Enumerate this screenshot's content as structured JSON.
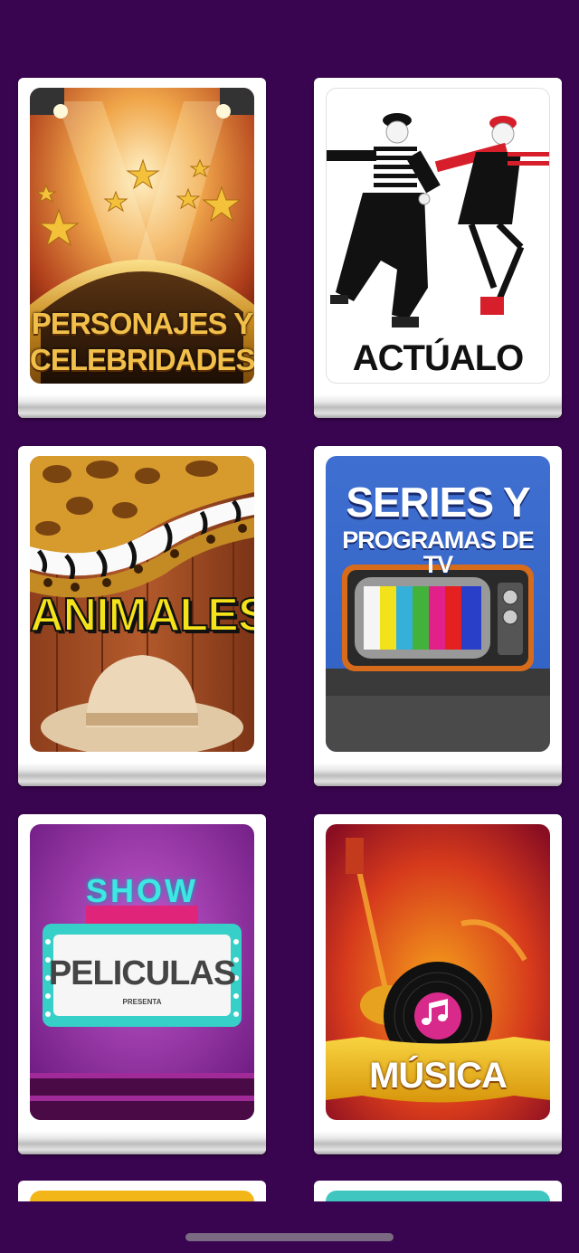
{
  "categories": [
    {
      "title": "PERSONAJES Y CELEBRIDADES",
      "line1": "PERSONAJES Y",
      "line2": "CELEBRIDADES",
      "icon": "spotlight-stars-icon"
    },
    {
      "title": "ACTÚALO",
      "line1": "ACTÚALO",
      "icon": "mimes-icon"
    },
    {
      "title": "ANIMALES",
      "line1": "ANIMALES",
      "icon": "animal-print-icon"
    },
    {
      "title": "SERIES Y PROGRAMAS DE TV",
      "line1": "SERIES Y",
      "line2": "PROGRAMAS DE TV",
      "icon": "retro-tv-icon"
    },
    {
      "title": "PELICULAS",
      "line1": "PELICULAS",
      "marquee": "SHOW",
      "small": "PRESENTA",
      "icon": "marquee-sign-icon"
    },
    {
      "title": "MÚSICA",
      "line1": "MÚSICA",
      "icon": "music-note-icon"
    }
  ],
  "colors": {
    "background": "#3a0550",
    "card": "#ffffff",
    "peek_left": "#f2b619",
    "peek_right": "#3fc6c1"
  }
}
